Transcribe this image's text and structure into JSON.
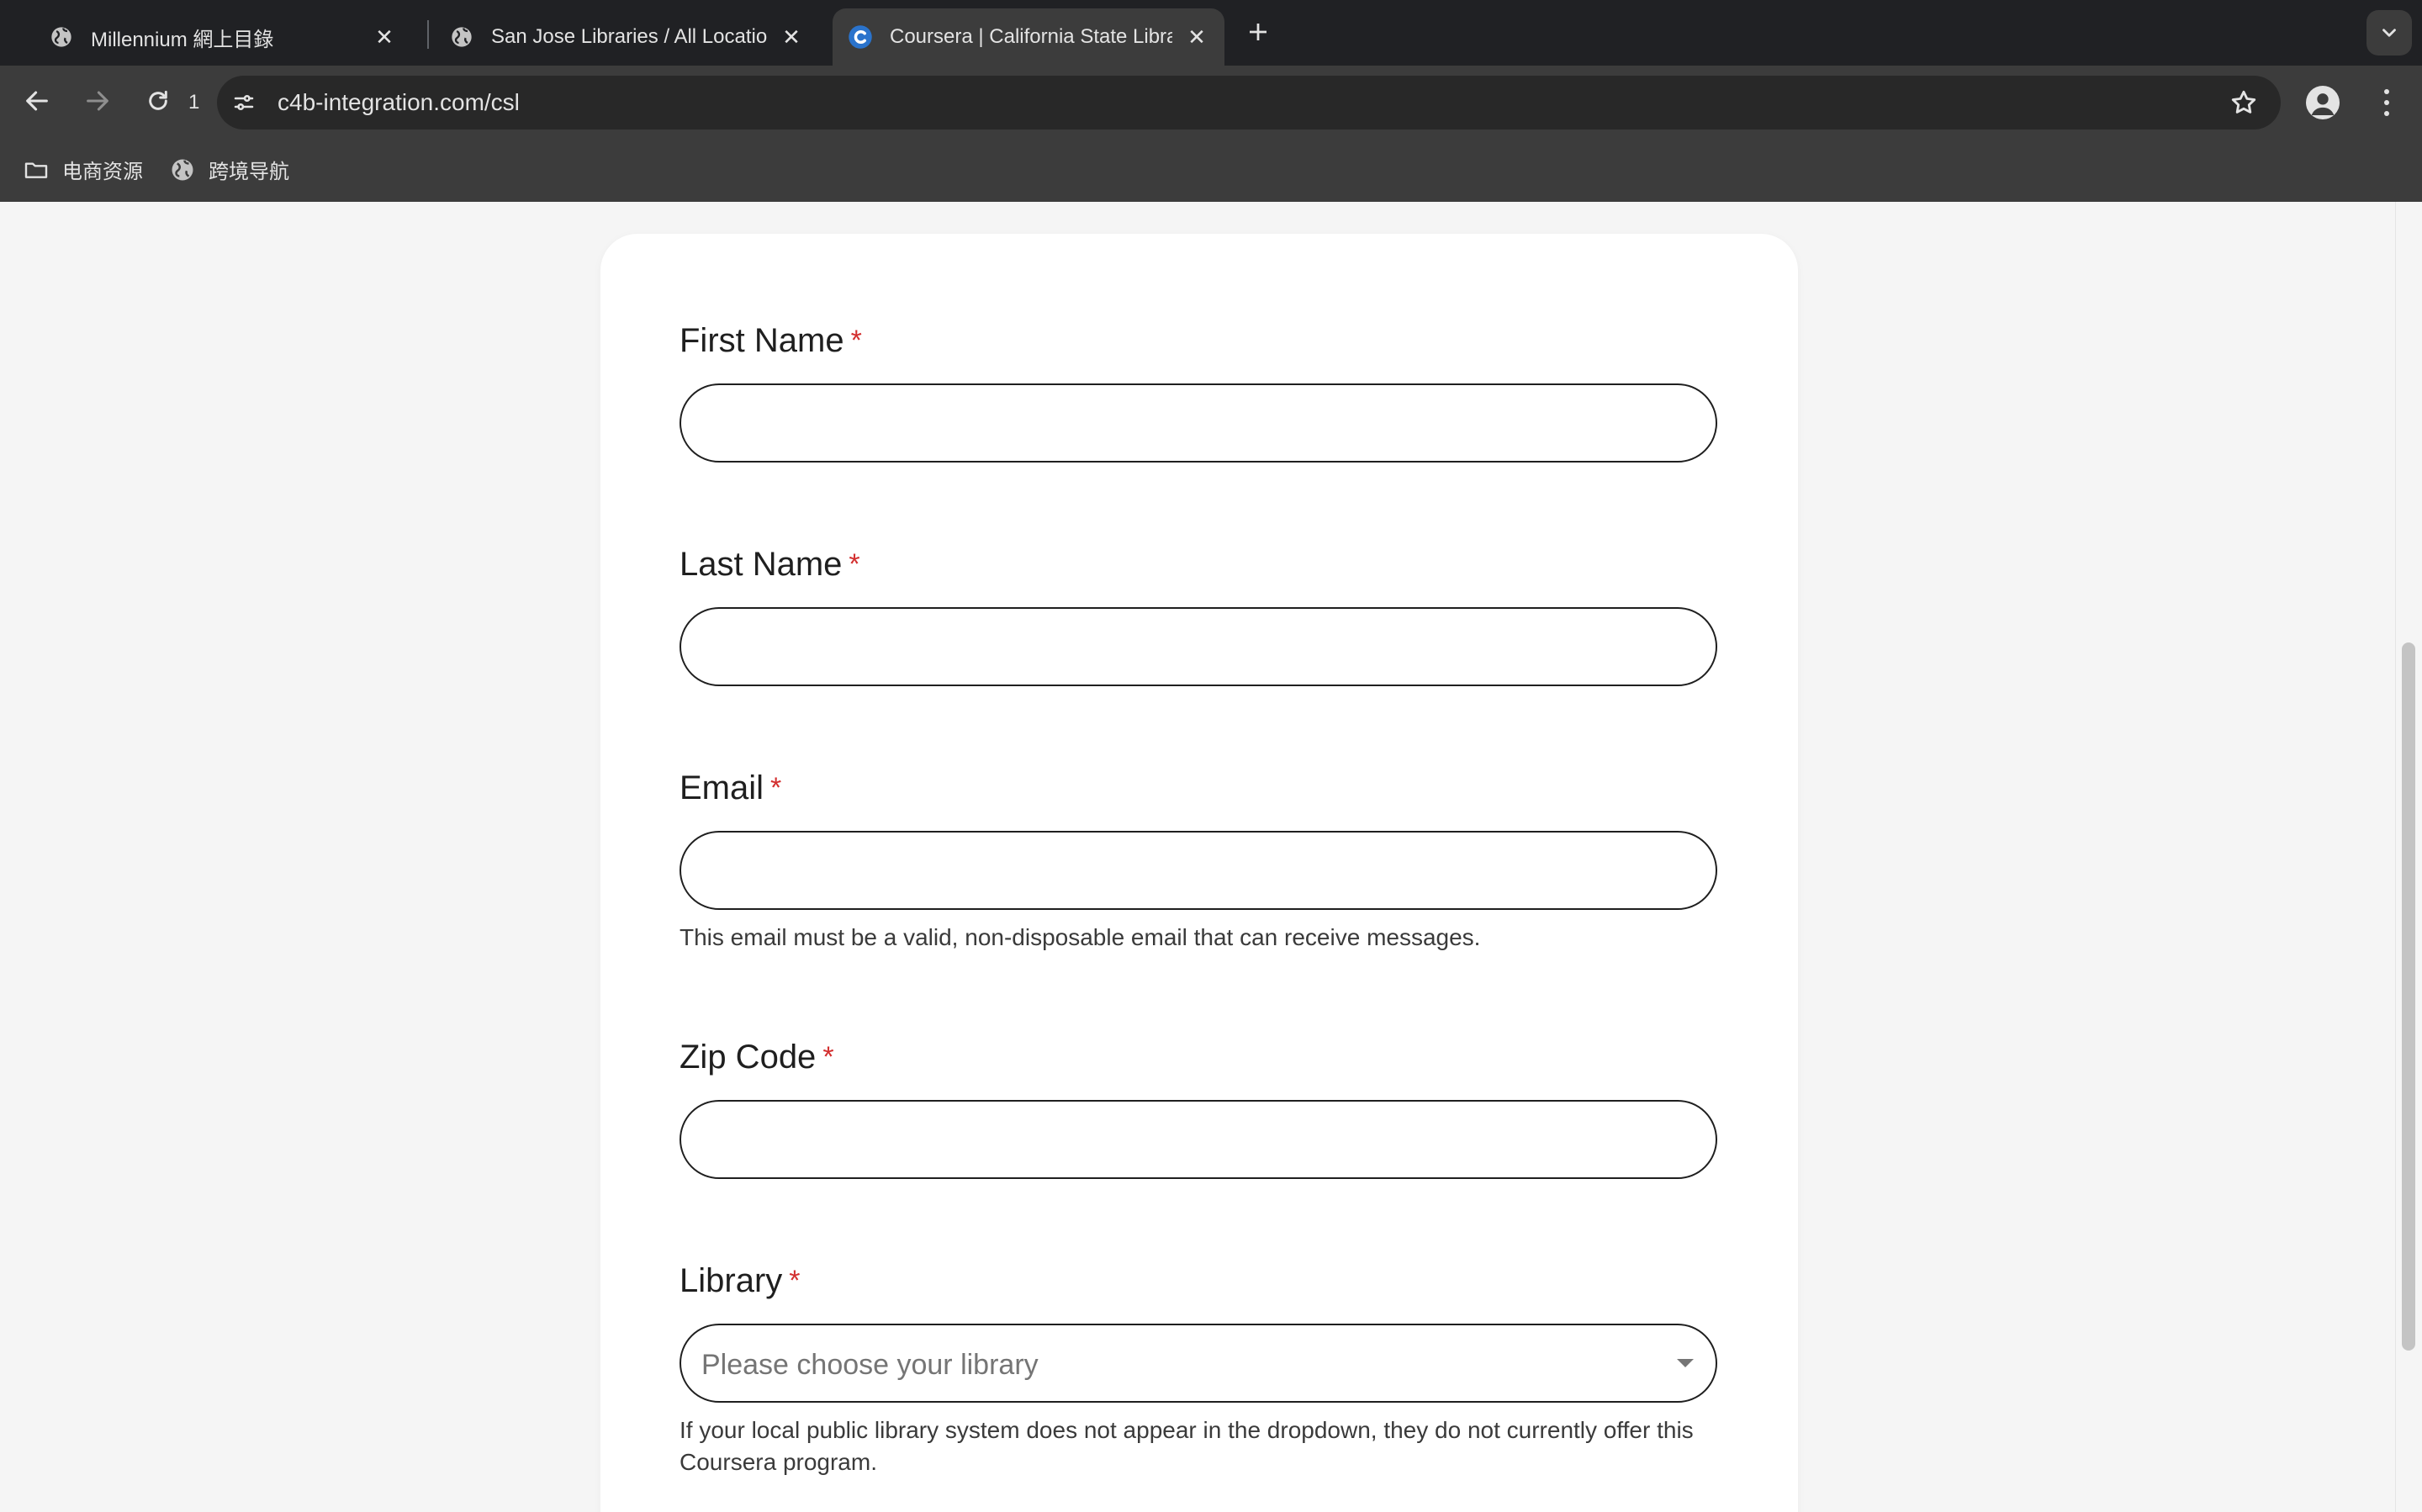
{
  "browser": {
    "tabs": [
      {
        "title": "Millennium 網上目錄",
        "active": false
      },
      {
        "title": "San Jose Libraries / All Locations",
        "active": false
      },
      {
        "title": "Coursera | California State Library",
        "active": true
      }
    ],
    "reload_count": "1",
    "url": "c4b-integration.com/csl",
    "bookmarks": [
      {
        "label": "电商资源",
        "icon": "folder-icon"
      },
      {
        "label": "跨境导航",
        "icon": "globe-icon"
      }
    ]
  },
  "form": {
    "first_name": {
      "label": "First Name",
      "required_mark": "*",
      "value": ""
    },
    "last_name": {
      "label": "Last Name",
      "required_mark": "*",
      "value": ""
    },
    "email": {
      "label": "Email",
      "required_mark": "*",
      "value": "",
      "help": "This email must be a valid, non-disposable email that can receive messages."
    },
    "zip_code": {
      "label": "Zip Code",
      "required_mark": "*",
      "value": ""
    },
    "library": {
      "label": "Library",
      "required_mark": "*",
      "placeholder": "Please choose your library",
      "help": "If your local public library system does not appear in the dropdown, they do not currently offer this Coursera program."
    }
  },
  "colors": {
    "tabstrip_bg": "#202124",
    "toolbar_bg": "#3c3c3c",
    "required": "#d32f2f",
    "input_border": "#1f1f1f",
    "coursera_brand": "#2a73cc"
  }
}
